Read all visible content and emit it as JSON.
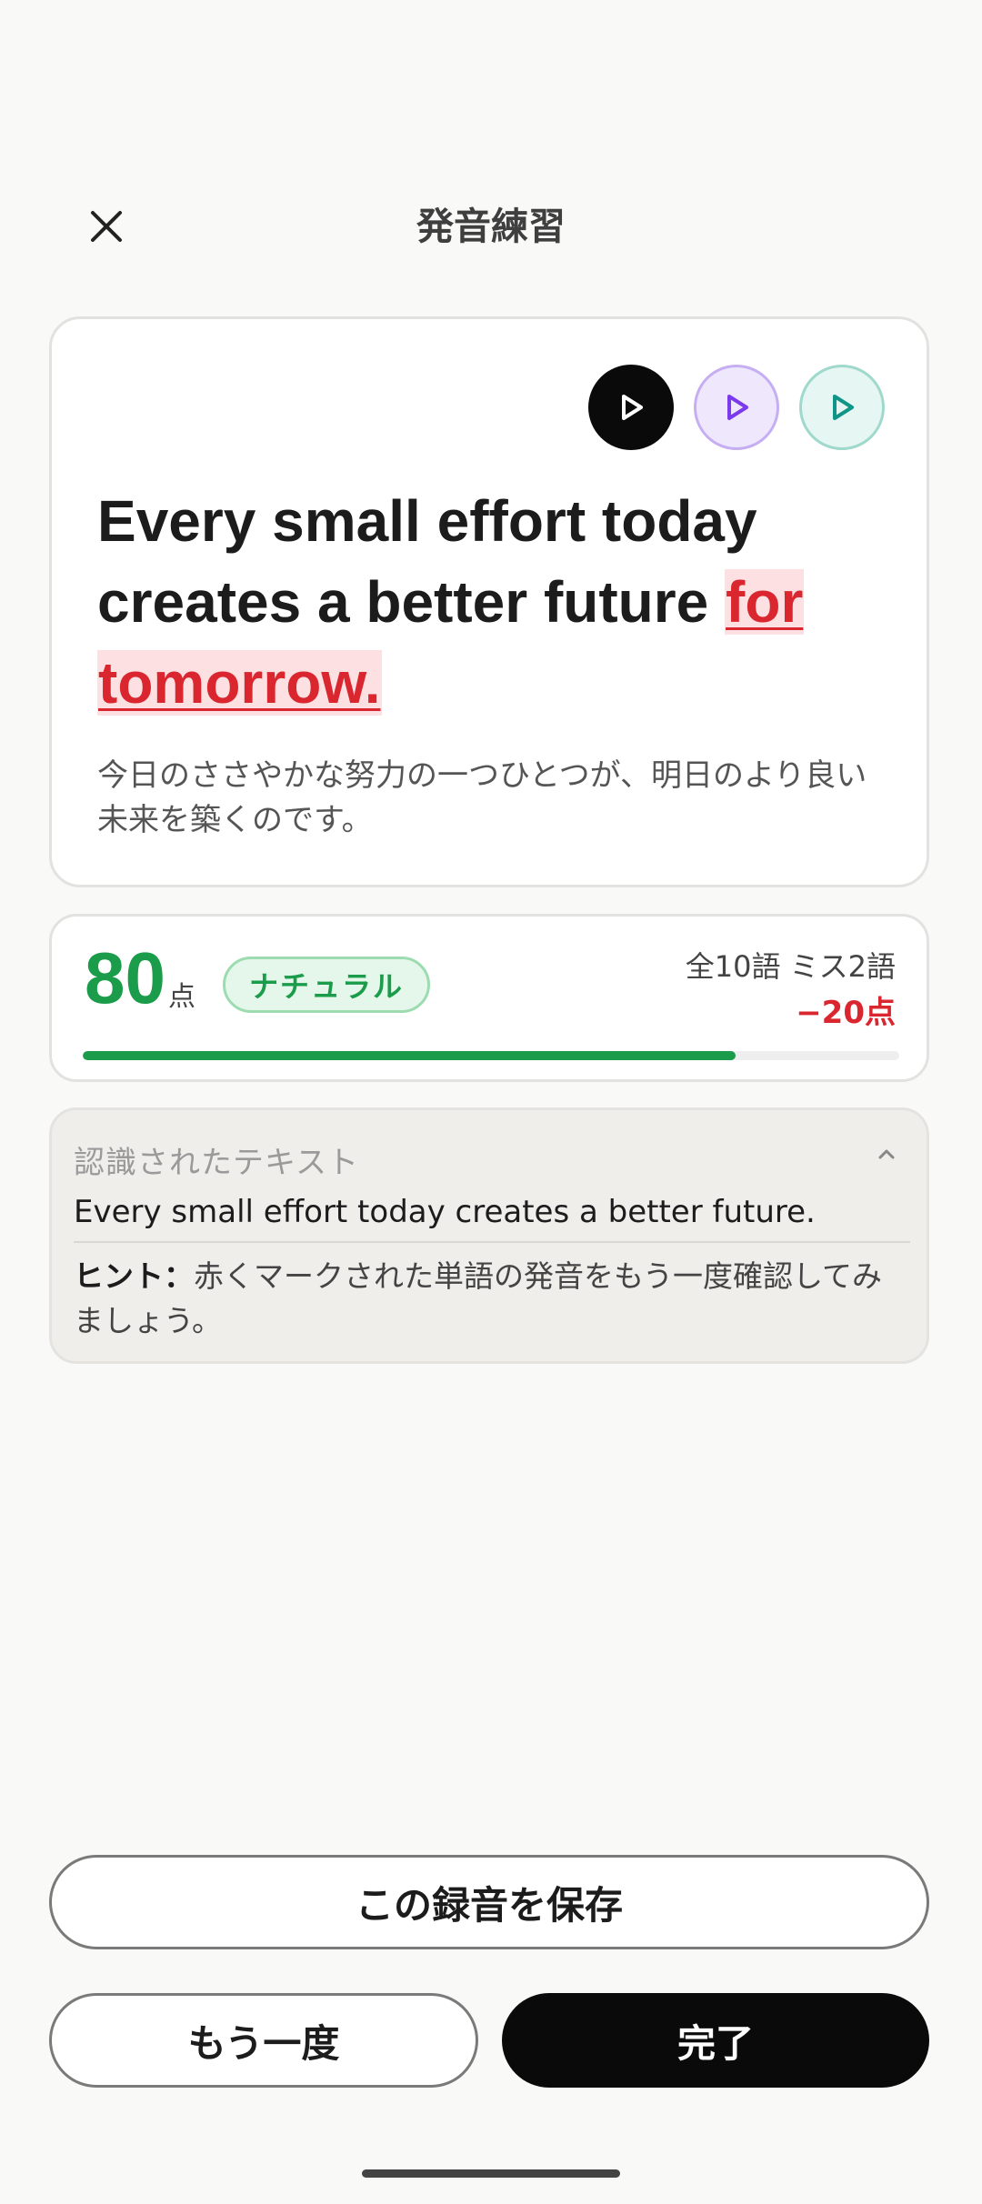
{
  "header": {
    "title": "発音練習",
    "close_icon": "close-icon"
  },
  "sentence_card": {
    "play_buttons": [
      {
        "name": "play-main",
        "icon": "play-icon",
        "color": "#0a0a0a"
      },
      {
        "name": "play-slow",
        "icon": "play-icon",
        "color": "#7c3aed"
      },
      {
        "name": "play-reference",
        "icon": "play-icon",
        "color": "#0f9488"
      }
    ],
    "sentence_correct": "Every small effort today creates a better future",
    "missed_words": [
      "for",
      "tomorrow."
    ],
    "translation": "今日のささやかな努力の一つひとつが、明日のより良い未来を築くのです。"
  },
  "score": {
    "points": "80",
    "unit": "点",
    "badge": "ナチュラル",
    "word_stats": "全10語 ミス2語",
    "penalty": "−20点",
    "progress_fraction": 0.8,
    "accent_color": "#1a9c4a",
    "error_color": "#d9262f"
  },
  "recognized": {
    "label": "認識されたテキスト",
    "text": "Every small effort today creates a better future.",
    "hint_label": "ヒント：",
    "hint_text": "赤くマークされた単語の発音をもう一度確認してみましょう。",
    "collapse_icon": "chevron-up-icon"
  },
  "actions": {
    "save": "この録音を保存",
    "retry": "もう一度",
    "done": "完了"
  }
}
